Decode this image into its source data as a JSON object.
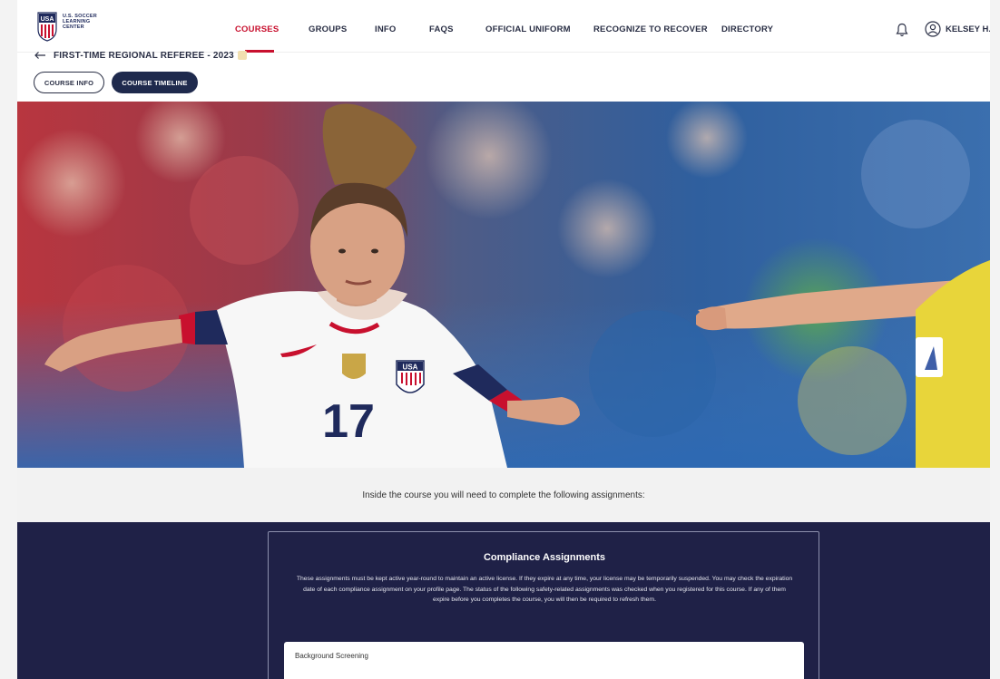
{
  "header": {
    "logo": {
      "shield_text": "USA",
      "lines": [
        "U.S. SOCCER",
        "LEARNING",
        "CENTER"
      ]
    },
    "nav": [
      {
        "label": "COURSES",
        "active": true
      },
      {
        "label": "GROUPS",
        "active": false
      },
      {
        "label": "INFO",
        "active": false
      },
      {
        "label": "FAQS",
        "active": false
      },
      {
        "label": "OFFICIAL UNIFORM",
        "active": false
      },
      {
        "label": "RECOGNIZE TO RECOVER",
        "active": false
      },
      {
        "label": "DIRECTORY",
        "active": false
      }
    ],
    "notification_icon": "bell-icon",
    "user_icon": "user-circle-icon",
    "user_name": "KELSEY H."
  },
  "breadcrumb": {
    "back_icon": "arrow-left-icon",
    "course_title": "FIRST-TIME REGIONAL REFEREE - 2023"
  },
  "tabs": [
    {
      "label": "COURSE INFO",
      "selected": false
    },
    {
      "label": "COURSE TIMELINE",
      "selected": true
    }
  ],
  "hero": {
    "jersey_number": "17",
    "badge_text": "USA"
  },
  "intro_text": "Inside the course you will need to complete the following assignments:",
  "compliance": {
    "title": "Compliance Assignments",
    "body": "These assignments must be kept active year-round to maintain an active license. If they expire at any time, your license may be temporarily suspended. You may check the expiration date of each compliance assignment on your profile page. The status of the following safety-related assignments was checked when you registered for this course. If any of them expire before you completes the course, you will then be required to refresh them.",
    "items": [
      {
        "title": "Background Screening"
      }
    ]
  },
  "colors": {
    "accent_red": "#c8102e",
    "navy": "#1f2147",
    "dark_text": "#2a2f45"
  }
}
